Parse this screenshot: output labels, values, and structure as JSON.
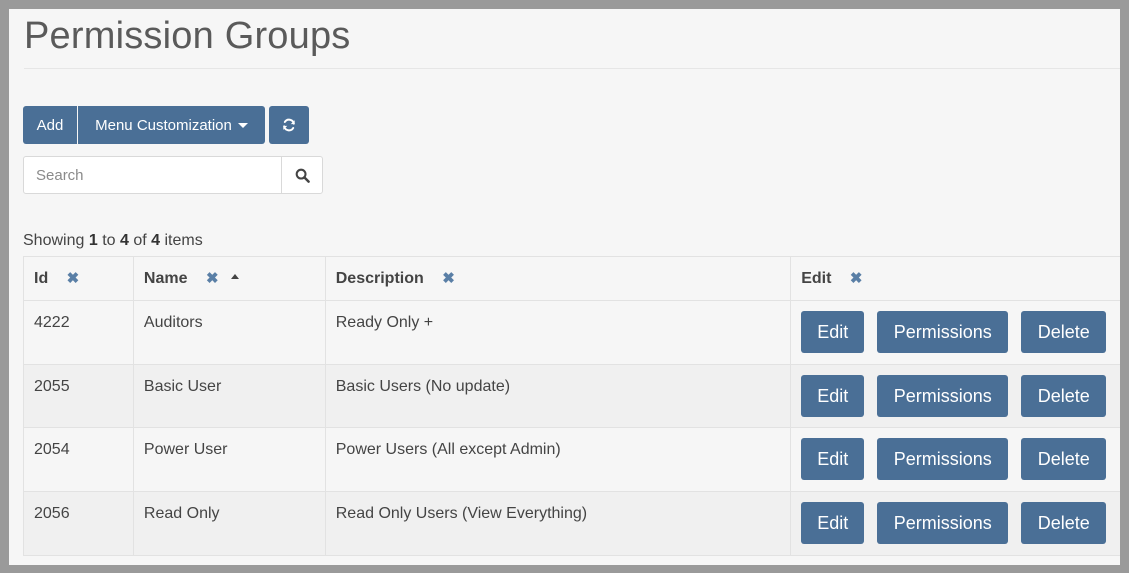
{
  "page": {
    "title": "Permission Groups"
  },
  "toolbar": {
    "add_label": "Add",
    "menu_label": "Menu Customization",
    "refresh_icon": "refresh-icon"
  },
  "search": {
    "placeholder": "Search",
    "icon": "search-icon"
  },
  "pagination": {
    "prefix": "Showing",
    "from": "1",
    "to_word": "to",
    "to": "4",
    "of_word": "of",
    "total": "4",
    "suffix": "items"
  },
  "table": {
    "columns": [
      {
        "label": "Id",
        "clearable": true
      },
      {
        "label": "Name",
        "clearable": true,
        "sort": "ascending"
      },
      {
        "label": "Description",
        "clearable": true
      },
      {
        "label": "Edit",
        "clearable": true
      }
    ],
    "clear_glyph": "✖",
    "rows": [
      {
        "id": "4222",
        "name": "Auditors",
        "description": "Ready Only +"
      },
      {
        "id": "2055",
        "name": "Basic User",
        "description": "Basic Users (No update)"
      },
      {
        "id": "2054",
        "name": "Power User",
        "description": "Power Users (All except Admin)"
      },
      {
        "id": "2056",
        "name": "Read Only",
        "description": "Read Only Users (View Everything)"
      }
    ],
    "actions": {
      "edit": "Edit",
      "permissions": "Permissions",
      "delete": "Delete"
    }
  },
  "colors": {
    "primary_button": "#4a6f96",
    "clear_icon": "#5a7fa6",
    "background": "#f6f6f6"
  }
}
